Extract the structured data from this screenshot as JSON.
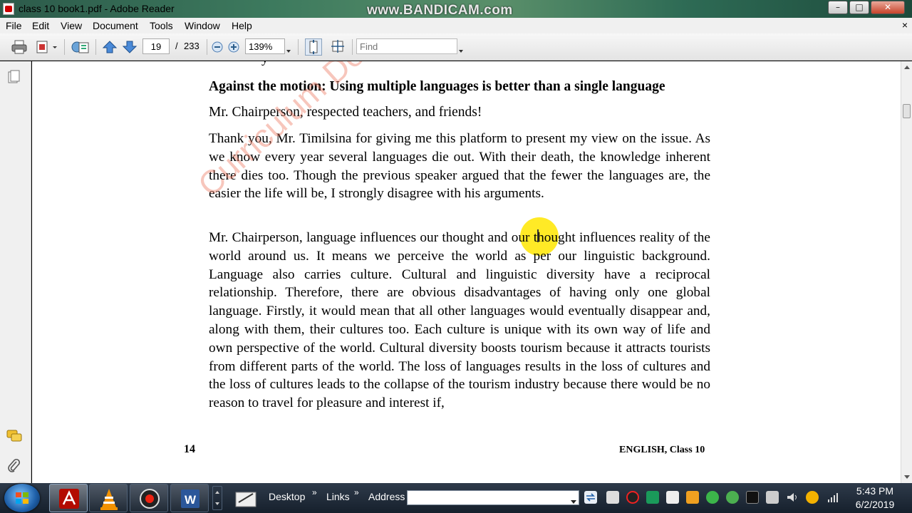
{
  "window": {
    "title": "class 10 book1.pdf - Adobe Reader",
    "overlay_watermark": "www.BANDICAM.com",
    "min_glyph": "–",
    "max_glyph": "□",
    "close_glyph": "✕"
  },
  "menu": {
    "items": [
      "File",
      "Edit",
      "View",
      "Document",
      "Tools",
      "Window",
      "Help"
    ],
    "close_doc_glyph": "×"
  },
  "toolbar": {
    "page_current": "19",
    "page_separator": "/",
    "page_total": "233",
    "zoom": "139%",
    "find_placeholder": "Find"
  },
  "document": {
    "top_fragment": "y",
    "heading": "Against the motion: Using multiple languages is better than a single language",
    "greeting": "Mr. Chairperson, respected teachers, and friends!",
    "paragraphs": [
      "Thank you, Mr. Timilsina for giving me this platform to present my view on the issue. As we know every year several languages die out. With their death, the knowledge inherent there dies too. Though the previous speaker argued that the fewer the languages are, the easier the life will be, I strongly disagree with his arguments.",
      "Mr. Chairperson, language influences our thought and our thought influences reality of the world around us. It means we perceive the world as per our linguistic background. Language also carries culture. Cultural and linguistic diversity have a reciprocal relationship. Therefore, there are obvious disadvantages of having only one global language. Firstly, it would mean that all other languages would eventually disappear and, along with them, their cultures too. Each culture is unique with its own way of life and own perspective of the world. Cultural diversity boosts tourism because it attracts tourists from different parts of the world. The loss of languages results in the loss of cultures and the loss of cultures leads to the collapse of the tourism industry because there would be no reason to travel for pleasure and interest if,"
    ],
    "watermark": "Curriculum Deve",
    "page_number": "14",
    "footer_title": "ENGLISH, Class 10"
  },
  "taskbar": {
    "desktop_label": "Desktop",
    "links_label": "Links",
    "address_label": "Address",
    "chevron": "»",
    "clock_time": "5:43 PM",
    "clock_date": "6/2/2019"
  },
  "colors": {
    "watermark": "#eb785f",
    "cursor_highlight": "#ffe600",
    "close_button": "#c7432a"
  }
}
